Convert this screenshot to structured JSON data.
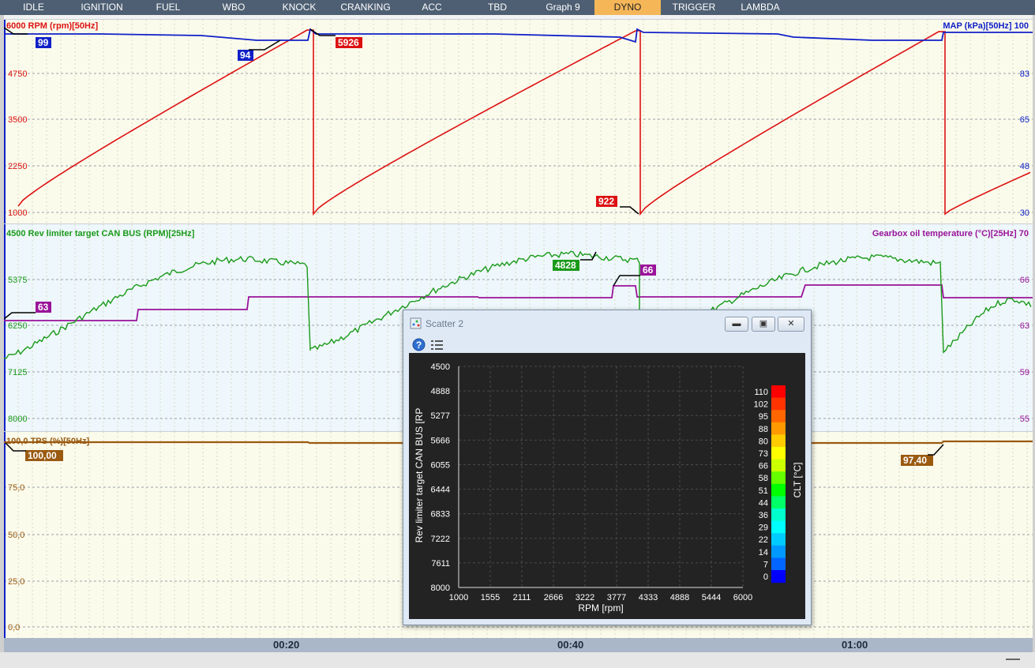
{
  "tabs": [
    "IDLE",
    "IGNITION",
    "FUEL",
    "WBO",
    "KNOCK",
    "CRANKING",
    "ACC",
    "TBD",
    "Graph 9",
    "DYNO",
    "TRIGGER",
    "LAMBDA"
  ],
  "active_tab": "DYNO",
  "panel1": {
    "left_title": "6000 RPM (rpm)[50Hz]",
    "right_title": "MAP (kPa)[50Hz] 100",
    "left_ticks": [
      "4750",
      "3500",
      "2250",
      "1000"
    ],
    "right_ticks": [
      "83",
      "65",
      "48",
      "30"
    ],
    "markers": [
      "99",
      "94",
      "5926",
      "922"
    ],
    "colors": {
      "rpm": "#dd1111",
      "map": "#1020c8"
    }
  },
  "panel2": {
    "left_title": "4500 Rev limiter target CAN BUS (RPM)[25Hz]",
    "right_title": "Gearbox oil temperature (°C)[25Hz] 70",
    "left_ticks": [
      "5375",
      "6250",
      "7125",
      "8000"
    ],
    "right_ticks": [
      "66",
      "63",
      "59",
      "55"
    ],
    "markers": [
      "63",
      "4828",
      "66"
    ],
    "colors": {
      "rev": "#1a9a1a",
      "oil": "#9a139a"
    }
  },
  "panel3": {
    "left_title": "100,0 TPS (%)[50Hz]",
    "left_ticks": [
      "75,0",
      "50,0",
      "25,0",
      "0,0"
    ],
    "markers": [
      "100,00",
      "97,40"
    ],
    "colors": {
      "tps": "#9a5a10"
    }
  },
  "time_labels": [
    "00:20",
    "00:40",
    "01:00"
  ],
  "scatter": {
    "window_title": "Scatter 2",
    "help_icon": "help-icon",
    "list_icon": "list-icon",
    "y_axis_title": "Rev limiter target CAN BUS [RP",
    "x_axis_title": "RPM [rpm]",
    "y_ticks": [
      "4500",
      "4888",
      "5277",
      "5666",
      "6055",
      "6444",
      "6833",
      "7222",
      "7611",
      "8000"
    ],
    "x_ticks": [
      "1000",
      "1555",
      "2111",
      "2666",
      "3222",
      "3777",
      "4333",
      "4888",
      "5444",
      "6000"
    ],
    "colorbar_title": "CLT [°C]",
    "colorbar_ticks": [
      "110",
      "102",
      "95",
      "88",
      "80",
      "73",
      "66",
      "58",
      "51",
      "44",
      "36",
      "29",
      "22",
      "14",
      "7",
      "0"
    ]
  }
}
